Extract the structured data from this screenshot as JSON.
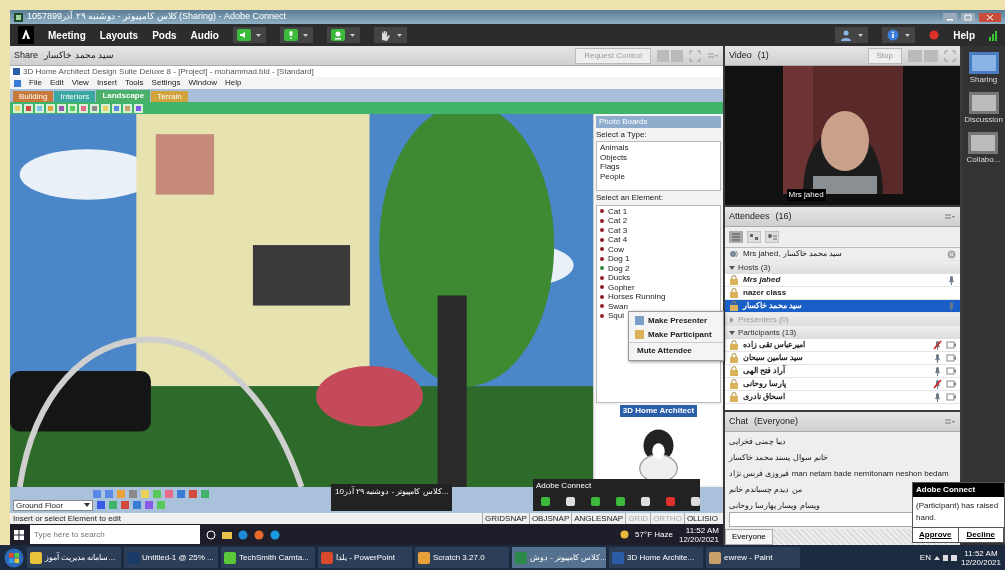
{
  "window": {
    "title": "کلاس کامپیوتر - دوشنبه ۲۹ آذر1057899 (Sharing) - Adobe Connect"
  },
  "menubar": {
    "items": [
      "Meeting",
      "Layouts",
      "Pods",
      "Audio"
    ],
    "help": "Help"
  },
  "share_pod": {
    "title": "Share",
    "presenter": "سید محمد خاکسار",
    "request_control": "Request Control"
  },
  "shared_app": {
    "title": "3D Home Architect Design Suite Deluxe 8 - [Project] - mohammad.bld - [Standard]",
    "menu": [
      "File",
      "Edit",
      "View",
      "Insert",
      "Tools",
      "Settings",
      "Window",
      "Help"
    ],
    "tabs": [
      {
        "label": "Building",
        "selected": false,
        "color": "#c87a3a"
      },
      {
        "label": "Interiors",
        "selected": false,
        "color": "#3aa8a0"
      },
      {
        "label": "Landscape",
        "selected": true,
        "color": "#4bb06a"
      },
      {
        "label": "Terrain",
        "selected": false,
        "color": "#d2a23c"
      }
    ],
    "panel": {
      "title": "Photo Boards",
      "type_label": "Select a Type:",
      "types": [
        "Animals",
        "Objects",
        "Flags",
        "People"
      ],
      "element_label": "Select an Element:",
      "elements": [
        {
          "label": "Cat 1",
          "color": "#8b1e2a"
        },
        {
          "label": "Cat 2",
          "color": "#8b1e2a"
        },
        {
          "label": "Cat 3",
          "color": "#8b1e2a"
        },
        {
          "label": "Cat 4",
          "color": "#8b1e2a"
        },
        {
          "label": "Cow",
          "color": "#8b1e2a"
        },
        {
          "label": "Dog 1",
          "color": "#8b1e2a"
        },
        {
          "label": "Dog 2",
          "color": "#2e8b3a"
        },
        {
          "label": "Ducks",
          "color": "#8b1e2a"
        },
        {
          "label": "Gopher",
          "color": "#8b1e2a"
        },
        {
          "label": "Horses Running",
          "color": "#8b1e2a"
        },
        {
          "label": "Swan",
          "color": "#8b1e2a"
        },
        {
          "label": "Squi",
          "color": "#8b1e2a"
        }
      ],
      "ad": "3D Home Architect"
    },
    "floor": "Ground Floor",
    "status": "Insert or select Element to edit",
    "snaps": [
      {
        "label": "GRIDSNAP",
        "on": true
      },
      {
        "label": "OBJSNAP",
        "on": true
      },
      {
        "label": "ANGLESNAP",
        "on": true
      },
      {
        "label": "GRID",
        "on": false
      },
      {
        "label": "ORTHO",
        "on": false
      },
      {
        "label": "OLLISIO",
        "on": true
      }
    ],
    "taskbar": {
      "placeholder": "Type here to search",
      "weather": "57°F  Haze",
      "time": "11:52 AM",
      "date": "12/20/2021"
    },
    "mini_window": {
      "title": "کلاس کامپیوتر - دوشنبه ۲۹ آذر10..."
    },
    "connect_widget": {
      "title": "Adobe Connect"
    }
  },
  "context_menu": {
    "items": [
      "Make Presenter",
      "Make Participant",
      "Mute Attendee"
    ]
  },
  "video_pod": {
    "title": "Video",
    "count": "(1)",
    "stop": "Stop",
    "name": "Mrs jahed"
  },
  "rail": [
    "Sharing",
    "Discussion",
    "Collabo..."
  ],
  "attendees": {
    "title": "Attendees",
    "count": "(16)",
    "speaking": "Mrs jahed, سید محمد خاکسار",
    "groups": [
      {
        "label": "Hosts (3)",
        "expanded": true,
        "items": [
          {
            "name": "Mrs jahed",
            "selected": false,
            "mic": true
          },
          {
            "name": "nazer class",
            "selected": false,
            "mic": false
          },
          {
            "name": "سید محمد خاکسار",
            "selected": true,
            "mic": true
          }
        ]
      },
      {
        "label": "Presenters (0)",
        "expanded": false
      },
      {
        "label": "Participants (13)",
        "expanded": true,
        "items": [
          {
            "name": "امیرعباس تقی زاده",
            "muted": true
          },
          {
            "name": "سید سامین سبحان",
            "muted": false
          },
          {
            "name": "آراد فتح الهی",
            "muted": false
          },
          {
            "name": "پارسا روحانی",
            "muted": true
          },
          {
            "name": "اسحاق نادری",
            "muted": false
          }
        ]
      }
    ]
  },
  "chat": {
    "title": "Chat",
    "scope": "(Everyone)",
    "messages": [
      "دیبا چمنی فخرایی",
      "خانم سوال پسند محمد خاکسار",
      "فیروزی فرنس نژاد man netam bade nemitonam neshon bedam",
      "من دیدم چسباندم خانم",
      "ویسام ویسار پهارسا روحانی"
    ],
    "tab": "Everyone"
  },
  "notification": {
    "title": "Adobe Connect",
    "text": "(Participant) has raised hand.",
    "buttons": [
      "Approve",
      "Decline"
    ]
  },
  "taskbar": {
    "apps": [
      {
        "label": "سامانه مدیریت آموز...",
        "selected": false
      },
      {
        "label": "Untitled-1 @ 25% ...",
        "selected": false
      },
      {
        "label": "TechSmith Camta...",
        "selected": false
      },
      {
        "label": "یلدا - PowerPoint",
        "selected": false
      },
      {
        "label": "Scratch 3.27.0",
        "selected": false
      },
      {
        "label": "کلاس کامپیوتر - دوش...",
        "selected": true
      },
      {
        "label": "3D Home Archite...",
        "selected": false
      },
      {
        "label": "ewrew - Paint",
        "selected": false
      }
    ],
    "lang": "EN",
    "time": "11:52 AM",
    "date": "12/20/2021"
  }
}
